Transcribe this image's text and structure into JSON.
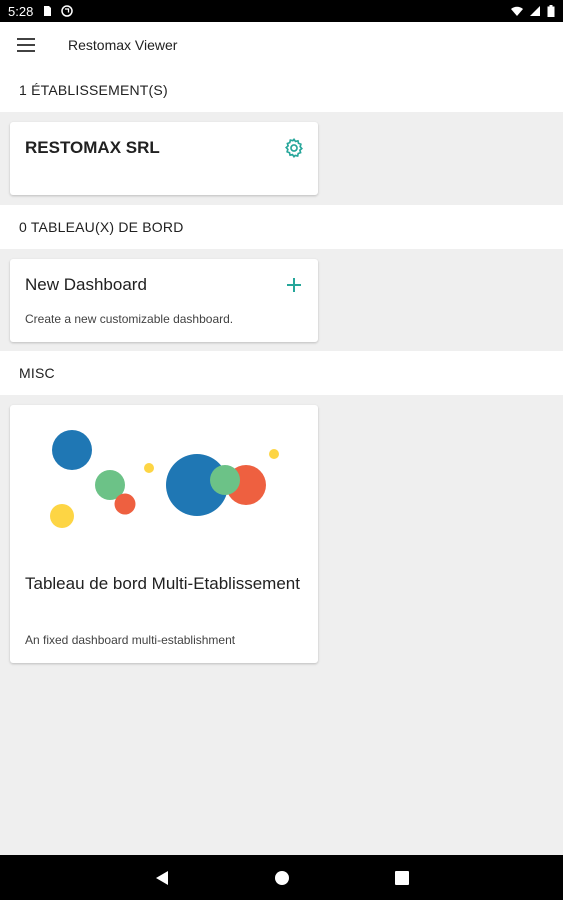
{
  "status_bar": {
    "time": "5:28",
    "icons": [
      "sd-card-icon",
      "sync-icon",
      "wifi-icon",
      "signal-icon",
      "battery-icon"
    ]
  },
  "app_bar": {
    "menu_icon": "hamburger-menu-icon",
    "title": "Restomax Viewer"
  },
  "sections": {
    "establishments": {
      "header": "1 ÉTABLISSEMENT(S)",
      "cards": [
        {
          "title": "RESTOMAX SRL",
          "action_icon": "gear-icon"
        }
      ]
    },
    "dashboards": {
      "header": "0 TABLEAU(X) DE BORD",
      "cards": [
        {
          "title": "New Dashboard",
          "subtitle": "Create a new customizable dashboard.",
          "action_icon": "plus-icon"
        }
      ]
    },
    "misc": {
      "header": "MISC",
      "cards": [
        {
          "title": "Tableau de bord Multi-Etablissement",
          "subtitle": "An fixed dashboard multi-establishment",
          "illustration": "colored-circles-illustration"
        }
      ]
    }
  },
  "colors": {
    "accent": "#26a69a",
    "blue": "#1f77b4",
    "green": "#6cc287",
    "orange": "#ee6040",
    "yellow": "#fdd544"
  },
  "nav_bar": [
    "back-icon",
    "home-icon",
    "recents-icon"
  ]
}
